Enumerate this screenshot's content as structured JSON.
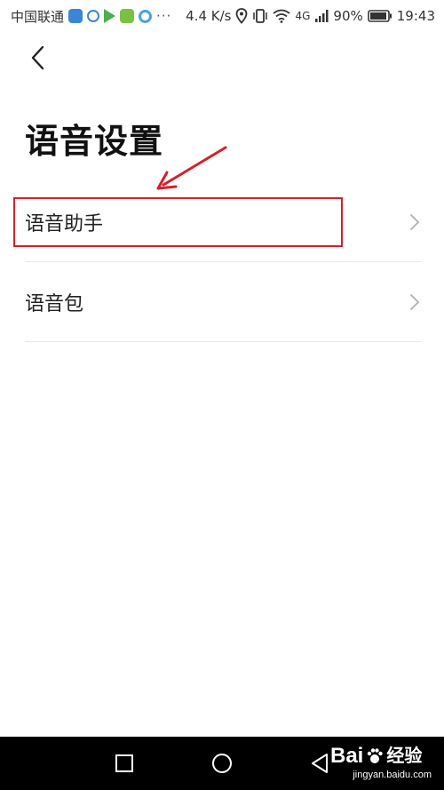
{
  "status_bar": {
    "carrier": "中国联通",
    "more": "···",
    "speed": "4.4 K/s",
    "network": "4G",
    "battery": "90%",
    "time": "19:43"
  },
  "page": {
    "title": "语音设置"
  },
  "menu": {
    "items": [
      {
        "label": "语音助手",
        "highlighted": true
      },
      {
        "label": "语音包",
        "highlighted": false
      }
    ]
  },
  "annotation": {
    "highlight_color": "#d6202a"
  },
  "watermark": {
    "brand": "Bai",
    "brand_suffix": "经验",
    "url": "jingyan.baidu.com"
  },
  "icons": {
    "back": "chevron-left-icon",
    "row_arrow": "chevron-right-icon",
    "nav_square": "recent-apps-icon",
    "nav_circle": "home-icon",
    "nav_triangle": "back-triangle-icon"
  }
}
